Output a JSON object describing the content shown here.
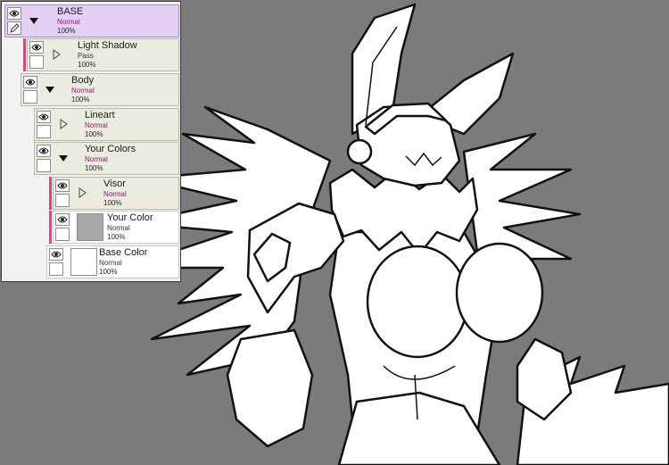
{
  "layers_panel": {
    "layers": [
      {
        "name": "BASE",
        "mode": "Normal",
        "opacity": "100%"
      },
      {
        "name": "Light Shadow",
        "mode": "Pass",
        "opacity": "100%"
      },
      {
        "name": "Body",
        "mode": "Normal",
        "opacity": "100%"
      },
      {
        "name": "Lineart",
        "mode": "Normal",
        "opacity": "100%"
      },
      {
        "name": "Your Colors",
        "mode": "Normal",
        "opacity": "100%"
      },
      {
        "name": "Visor",
        "mode": "Normal",
        "opacity": "100%"
      },
      {
        "name": "Your Color",
        "mode": "Normal",
        "opacity": "100%"
      },
      {
        "name": "Base Color",
        "mode": "Normal",
        "opacity": "100%"
      }
    ]
  },
  "icons": {
    "visibility": "eye-icon",
    "edit": "pencil-icon",
    "expanded": "triangle-down-icon",
    "collapsed": "triangle-right-icon"
  },
  "colors": {
    "canvas_background": "#7b7b7b",
    "selected_layer": "#e4d0f4",
    "clipping_bar": "#d34a83",
    "blend_mode_text": "#8c1a7a"
  }
}
